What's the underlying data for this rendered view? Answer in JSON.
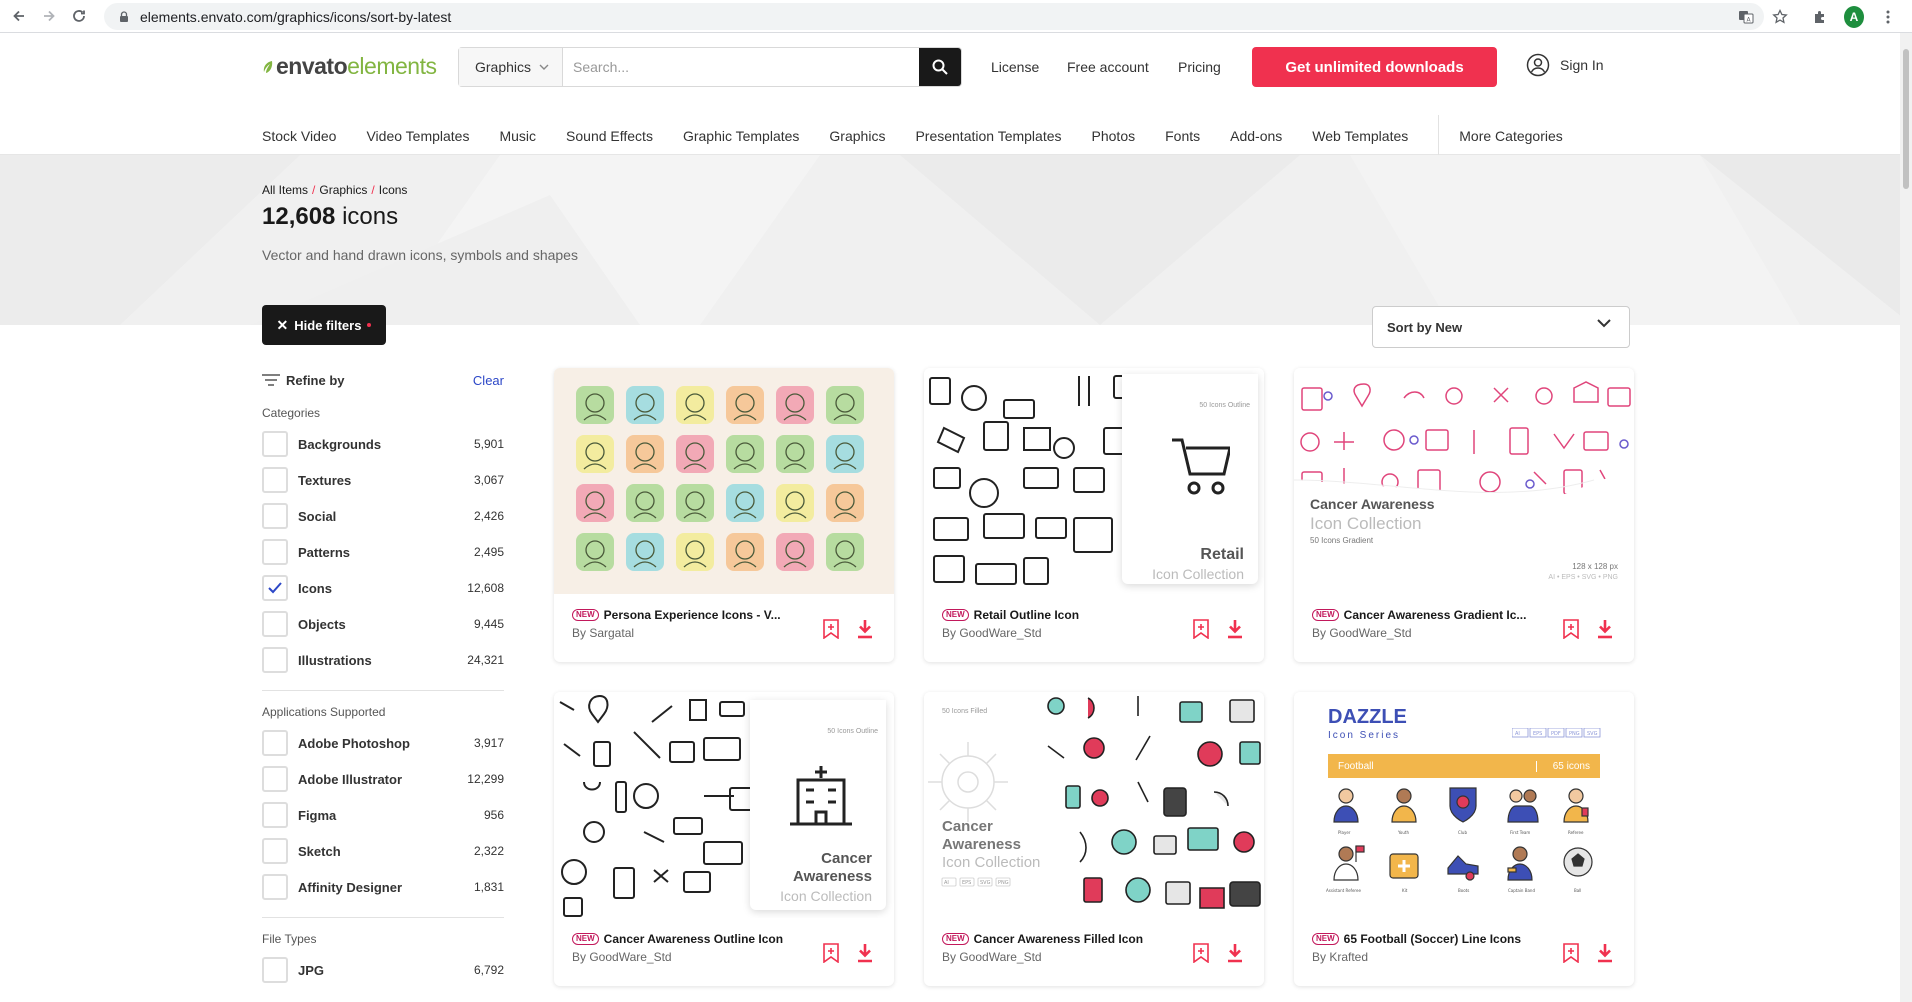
{
  "browser": {
    "url": "elements.envato.com/graphics/icons/sort-by-latest",
    "profile_initial": "A"
  },
  "header": {
    "logo_a": "envato",
    "logo_b": "elements",
    "search_category": "Graphics",
    "search_placeholder": "Search...",
    "links": [
      "License",
      "Free account",
      "Pricing"
    ],
    "cta": "Get unlimited downloads",
    "signin": "Sign In"
  },
  "categories_nav": [
    "Stock Video",
    "Video Templates",
    "Music",
    "Sound Effects",
    "Graphic Templates",
    "Graphics",
    "Presentation Templates",
    "Photos",
    "Fonts",
    "Add-ons",
    "Web Templates"
  ],
  "more_categories": "More Categories",
  "hero": {
    "crumbs": [
      "All Items",
      "Graphics",
      "Icons"
    ],
    "count": "12,608",
    "count_label": "icons",
    "subtitle": "Vector and hand drawn icons, symbols and shapes",
    "hide_filters": "Hide filters",
    "sort": "Sort by New"
  },
  "sidebar": {
    "refine": "Refine by",
    "clear": "Clear",
    "groups": [
      {
        "title": "Categories",
        "items": [
          {
            "label": "Backgrounds",
            "count": "5,901",
            "checked": false
          },
          {
            "label": "Textures",
            "count": "3,067",
            "checked": false
          },
          {
            "label": "Social",
            "count": "2,426",
            "checked": false
          },
          {
            "label": "Patterns",
            "count": "2,495",
            "checked": false
          },
          {
            "label": "Icons",
            "count": "12,608",
            "checked": true
          },
          {
            "label": "Objects",
            "count": "9,445",
            "checked": false
          },
          {
            "label": "Illustrations",
            "count": "24,321",
            "checked": false
          }
        ]
      },
      {
        "title": "Applications Supported",
        "items": [
          {
            "label": "Adobe Photoshop",
            "count": "3,917",
            "checked": false
          },
          {
            "label": "Adobe Illustrator",
            "count": "12,299",
            "checked": false
          },
          {
            "label": "Figma",
            "count": "956",
            "checked": false
          },
          {
            "label": "Sketch",
            "count": "2,322",
            "checked": false
          },
          {
            "label": "Affinity Designer",
            "count": "1,831",
            "checked": false
          }
        ]
      },
      {
        "title": "File Types",
        "items": [
          {
            "label": "JPG",
            "count": "6,792",
            "checked": false
          }
        ]
      }
    ]
  },
  "cards": [
    {
      "badge": "NEW",
      "title": "Persona Experience Icons - V...",
      "author": "By Sargatal",
      "thumb": "persona"
    },
    {
      "badge": "NEW",
      "title": "Retail Outline Icon",
      "author": "By GoodWare_Std",
      "thumb": "retail",
      "overlay_badge": "50 Icons Outline",
      "overlay_title": "Retail",
      "overlay_sub": "Icon Collection"
    },
    {
      "badge": "NEW",
      "title": "Cancer Awareness Gradient Ic...",
      "author": "By GoodWare_Std",
      "thumb": "cancer-gradient",
      "overlay_title": "Cancer Awareness",
      "overlay_sub": "Icon Collection",
      "overlay_small": "50 Icons Gradient",
      "overlay_size": "128 x 128 px",
      "overlay_formats": "AI • EPS • SVG • PNG"
    },
    {
      "badge": "NEW",
      "title": "Cancer Awareness Outline Icon",
      "author": "By GoodWare_Std",
      "thumb": "cancer-outline",
      "overlay_badge": "50 Icons Outline",
      "overlay_title_1": "Cancer",
      "overlay_title_2": "Awareness",
      "overlay_sub": "Icon Collection"
    },
    {
      "badge": "NEW",
      "title": "Cancer Awareness Filled Icon",
      "author": "By GoodWare_Std",
      "thumb": "cancer-filled",
      "overlay_badge": "50 Icons Filled",
      "overlay_title_1": "Cancer",
      "overlay_title_2": "Awareness",
      "overlay_sub": "Icon Collection",
      "overlay_formats": [
        "AI",
        "EPS",
        "SVG",
        "PNG"
      ]
    },
    {
      "badge": "NEW",
      "title": "65 Football (Soccer) Line Icons",
      "author": "By Krafted",
      "thumb": "dazzle",
      "overlay_title": "DAZZLE",
      "overlay_sub": "Icon Series",
      "overlay_formats": [
        "AI",
        "EPS",
        "PDF",
        "PNG",
        "SVG"
      ],
      "band_label": "Football",
      "band_count": "65 icons",
      "icon_labels": [
        "Player",
        "Youth",
        "Club",
        "First Team",
        "Referee",
        "Assistant Referee",
        "Kit",
        "Boots",
        "Captain Band",
        "Ball"
      ]
    }
  ],
  "colors": {
    "accent": "#f0314f",
    "brand_green": "#82b541",
    "link_blue": "#2c47c7",
    "badge_pink": "#c2185b"
  }
}
